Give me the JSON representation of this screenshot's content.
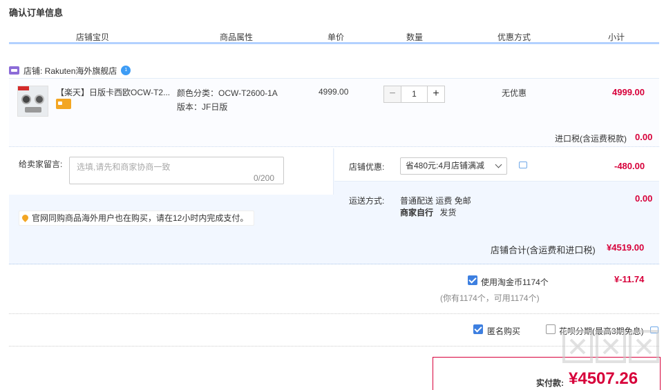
{
  "page_title": "确认订单信息",
  "columns": [
    "店铺宝贝",
    "商品属性",
    "单价",
    "数量",
    "优惠方式",
    "小计"
  ],
  "shop": {
    "label": "店铺: Rakuten海外旗舰店",
    "badge": "1"
  },
  "item": {
    "name": "【楽天】日版卡西欧OCW-T2...",
    "attr_color": "颜色分类：OCW-T2600-1A",
    "attr_version": "版本：JF日版",
    "price": "4999.00",
    "quantity": "1",
    "discount": "无优惠",
    "subtotal": "4999.00"
  },
  "tax": {
    "label": "进口税(含运费税款)",
    "value": "0.00"
  },
  "message": {
    "label": "给卖家留言:",
    "placeholder": "选填,请先和商家协商一致",
    "count": "0/200"
  },
  "notice": "官网同购商品海外用户也在购买，请在12小时内完成支付。",
  "shop_discount": {
    "label": "店铺优惠:",
    "selected": "省480元:4月店铺满减",
    "value": "-480.00"
  },
  "shipping": {
    "label": "运送方式:",
    "line1": "普通配送 运费 免邮",
    "line2_bold": "商家自行",
    "line2_rest": "发货",
    "value": "0.00"
  },
  "shop_total": {
    "label": "店铺合计(含运费和进口税)",
    "value": "¥4519.00"
  },
  "coins": {
    "label": "使用淘金币1174个",
    "value": "¥-11.74",
    "note": "(你有1174个，可用1174个)"
  },
  "anonymous": {
    "label": "匿名购买",
    "checked": true
  },
  "huabei": {
    "label": "花呗分期(最高3期免息)",
    "checked": false
  },
  "payment": {
    "label": "实付款:",
    "value": "¥4507.26"
  },
  "colors": {
    "accent": "#d7003a",
    "header_rule": "#b2d1ff",
    "panel": "#f2f7ff",
    "check": "#3d7fe0"
  }
}
